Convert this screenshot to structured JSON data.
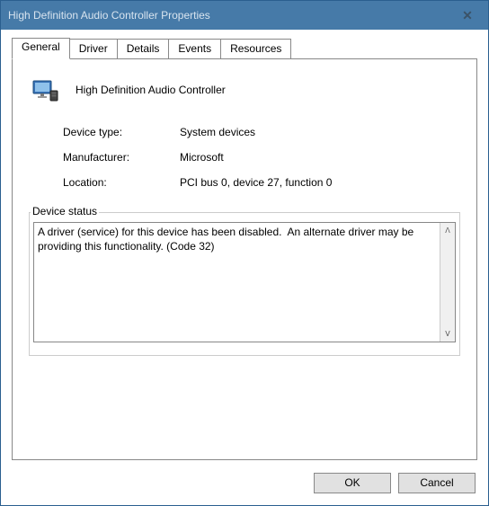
{
  "window": {
    "title": "High Definition Audio Controller Properties"
  },
  "tabs": {
    "general": "General",
    "driver": "Driver",
    "details": "Details",
    "events": "Events",
    "resources": "Resources"
  },
  "device": {
    "name": "High Definition Audio Controller",
    "labels": {
      "type": "Device type:",
      "manufacturer": "Manufacturer:",
      "location": "Location:"
    },
    "values": {
      "type": "System devices",
      "manufacturer": "Microsoft",
      "location": "PCI bus 0, device 27, function 0"
    }
  },
  "status": {
    "legend": "Device status",
    "text": "A driver (service) for this device has been disabled.  An alternate driver may be providing this functionality. (Code 32)"
  },
  "buttons": {
    "ok": "OK",
    "cancel": "Cancel"
  }
}
